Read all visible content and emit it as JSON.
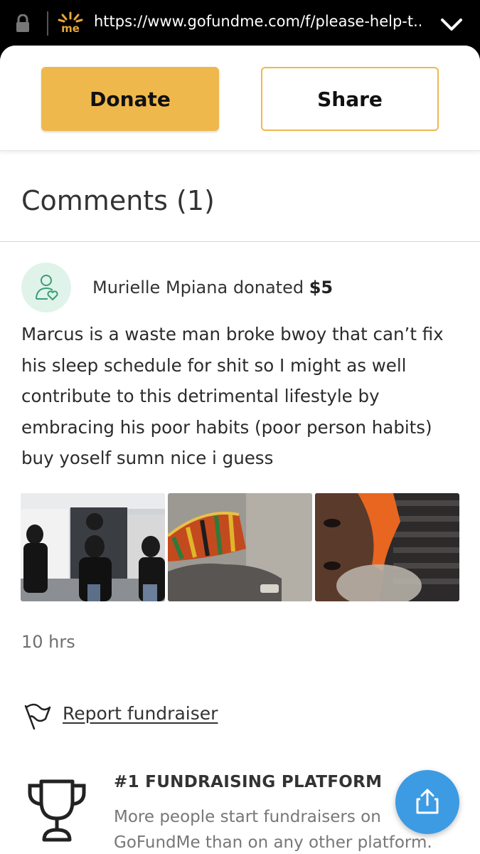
{
  "browser": {
    "url": "https://www.gofundme.com/f/please-help-t..."
  },
  "actions": {
    "donate_label": "Donate",
    "share_label": "Share"
  },
  "comments": {
    "title": "Comments (1)",
    "items": [
      {
        "donor_name": "Murielle Mpiana",
        "donated_word": "donated",
        "amount": "$5",
        "text": "Marcus is a waste man broke bwoy that can’t fix his sleep schedule for shit so I might as well contribute to this detrimental lifestyle by embracing his poor habits (poor person habits) buy yoself sumn nice i guess",
        "timestamp": "10 hrs"
      }
    ]
  },
  "report": {
    "label": "Report fundraiser"
  },
  "promo": {
    "title": "#1 FUNDRAISING PLATFORM",
    "text": "More people start fundraisers on GoFundMe than on any other platform."
  },
  "colors": {
    "accent": "#efb84d",
    "fab": "#3c9be3",
    "avatar_bg": "#dff3ea",
    "avatar_icon": "#3a9e72"
  },
  "icons": [
    "lock-icon",
    "site-logo",
    "chevron-down-icon",
    "user-heart-icon",
    "flag-icon",
    "trophy-icon",
    "share-icon"
  ]
}
